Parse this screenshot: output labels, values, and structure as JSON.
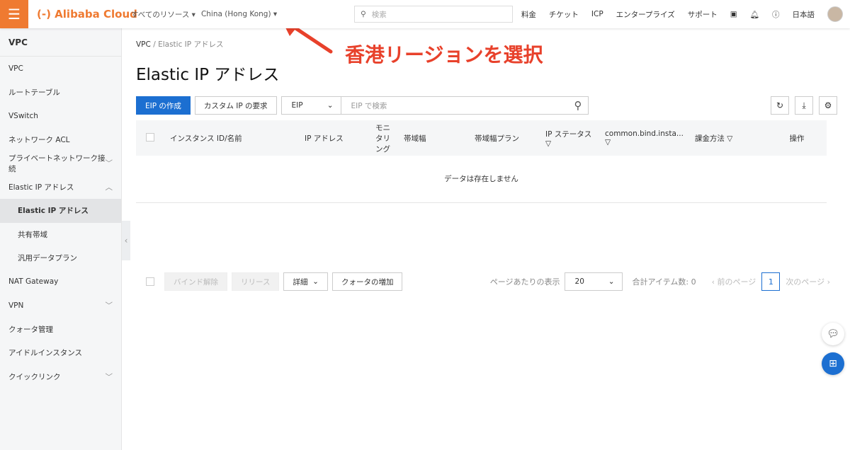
{
  "header": {
    "menu_icon": "hamburger-icon",
    "logo": "Alibaba Cloud",
    "resources": "すべてのリソース",
    "region": "China (Hong Kong)",
    "search_placeholder": "検索",
    "nav": [
      "料金",
      "チケット",
      "ICP",
      "エンタープライズ",
      "サポート"
    ],
    "language": "日本語"
  },
  "sidebar": {
    "title": "VPC",
    "items": [
      {
        "label": "VPC"
      },
      {
        "label": "ルートテーブル"
      },
      {
        "label": "VSwitch"
      },
      {
        "label": "ネットワーク ACL"
      },
      {
        "label": "プライベートネットワーク接続",
        "chevron": "down"
      },
      {
        "label": "Elastic IP アドレス",
        "chevron": "up"
      },
      {
        "label": "Elastic IP アドレス",
        "sub": true,
        "active": true
      },
      {
        "label": "共有帯域",
        "sub": true
      },
      {
        "label": "汎用データプラン",
        "sub": true
      },
      {
        "label": "NAT Gateway"
      },
      {
        "label": "VPN",
        "chevron": "down"
      },
      {
        "label": "クォータ管理"
      },
      {
        "label": "アイドルインスタンス"
      },
      {
        "label": "クイックリンク",
        "chevron": "down"
      }
    ]
  },
  "breadcrumb": [
    "VPC",
    "Elastic IP アドレス"
  ],
  "page_title": "Elastic IP アドレス",
  "toolbar": {
    "create": "EIP の作成",
    "custom": "カスタム IP の要求",
    "filter": "EIP",
    "search_placeholder": "EIP で検索"
  },
  "table": {
    "columns": [
      "インスタンス ID/名前",
      "IP アドレス",
      "モニタリング",
      "帯域幅",
      "帯域幅プラン",
      "IP ステータス",
      "common.bind.insta...",
      "課金方法",
      "操作"
    ],
    "empty": "データは存在しません"
  },
  "footer": {
    "unbind": "バインド解除",
    "release": "リリース",
    "details": "詳細",
    "quota": "クォータの増加",
    "per_page_label": "ページあたりの表示",
    "per_page": "20",
    "total": "合計アイテム数: 0",
    "prev": "前のページ",
    "page": "1",
    "next": "次のページ"
  },
  "annotation": "香港リージョンを選択",
  "colors": {
    "brand": "#ef7a31",
    "primary": "#1c6fd1",
    "annotation": "#e8412b"
  }
}
